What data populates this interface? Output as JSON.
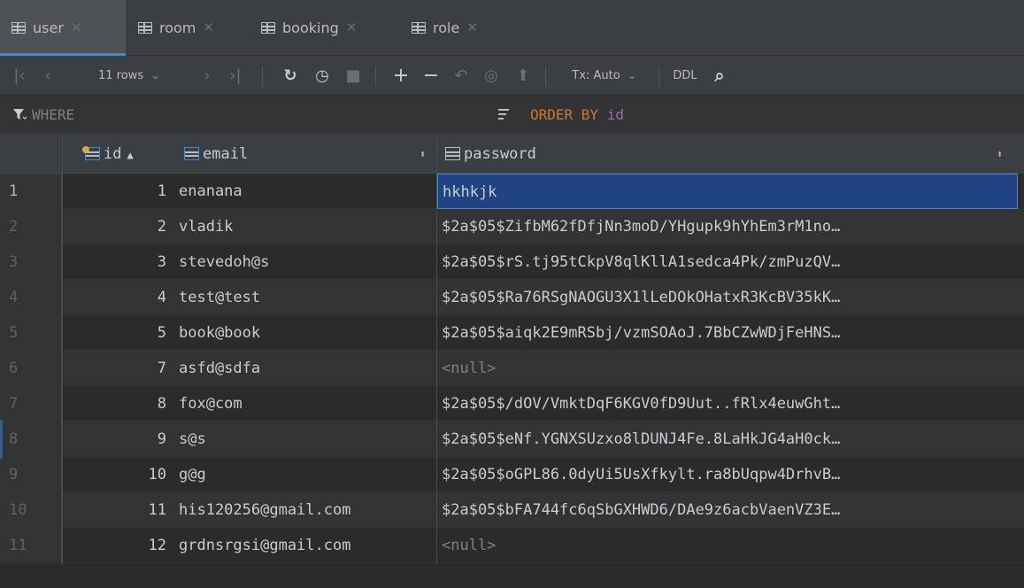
{
  "tabs": [
    {
      "label": "user",
      "active": true
    },
    {
      "label": "room",
      "active": false
    },
    {
      "label": "booking",
      "active": false
    },
    {
      "label": "role",
      "active": false
    }
  ],
  "toolbar": {
    "rows_label": "11 rows",
    "tx_label": "Tx: Auto",
    "ddl_label": "DDL"
  },
  "filter": {
    "where_label": "WHERE",
    "order_keyword": "ORDER BY",
    "order_column": "id"
  },
  "columns": [
    "id",
    "email",
    "password"
  ],
  "rows": [
    {
      "n": "1",
      "id": "1",
      "email": "enanana",
      "password": "hkhkjk"
    },
    {
      "n": "2",
      "id": "2",
      "email": "vladik",
      "password": "$2a$05$ZifbM62fDfjNn3moD/YHgupk9hYhEm3rM1no…"
    },
    {
      "n": "3",
      "id": "3",
      "email": "stevedoh@s",
      "password": "$2a$05$rS.tj95tCkpV8qlKllA1sedca4Pk/zmPuzQV…"
    },
    {
      "n": "4",
      "id": "4",
      "email": "test@test",
      "password": "$2a$05$Ra76RSgNAOGU3X1lLeDOkOHatxR3KcBV35kK…"
    },
    {
      "n": "5",
      "id": "5",
      "email": "book@book",
      "password": "$2a$05$aiqk2E9mRSbj/vzmSOAoJ.7BbCZwWDjFeHNS…"
    },
    {
      "n": "6",
      "id": "7",
      "email": "asfd@sdfa",
      "password": "<null>"
    },
    {
      "n": "7",
      "id": "8",
      "email": "fox@com",
      "password": "$2a$05$/dOV/VmktDqF6KGV0fD9Uut..fRlx4euwGht…"
    },
    {
      "n": "8",
      "id": "9",
      "email": "s@s",
      "password": "$2a$05$eNf.YGNXSUzxo8lDUNJ4Fe.8LaHkJG4aH0ck…"
    },
    {
      "n": "9",
      "id": "10",
      "email": "g@g",
      "password": "$2a$05$oGPL86.0dyUi5UsXfkylt.ra8bUqpw4DrhvB…"
    },
    {
      "n": "10",
      "id": "11",
      "email": "his120256@gmail.com",
      "password": "$2a$05$bFA744fc6qSbGXHWD6/DAe9z6acbVaenVZ3E…"
    },
    {
      "n": "11",
      "id": "12",
      "email": "grdnsrgsi@gmail.com",
      "password": "<null>"
    }
  ]
}
